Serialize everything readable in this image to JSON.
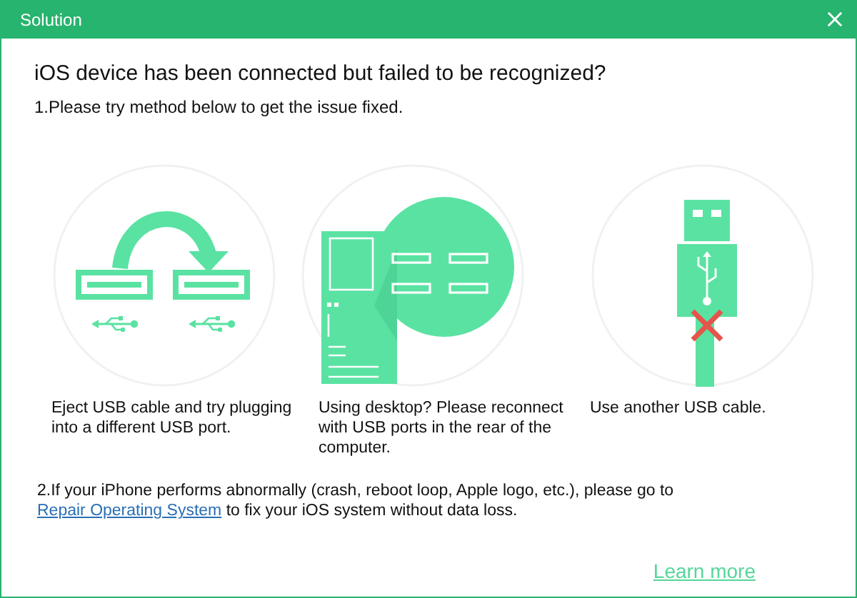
{
  "window": {
    "title": "Solution"
  },
  "heading": "iOS device has been connected but failed to be recognized?",
  "step_1": "1.Please try method below to get the issue fixed.",
  "methods": [
    {
      "kind": "swap",
      "caption": "Eject USB cable and try plugging into a different USB port."
    },
    {
      "kind": "desktop",
      "caption": "Using desktop? Please reconnect with USB ports in the rear of the computer."
    },
    {
      "kind": "cable",
      "caption": "Use another USB cable."
    }
  ],
  "step_2": {
    "before": "2.If your iPhone performs abnormally (crash, reboot loop, Apple logo, etc.), please go to",
    "link": "Repair Operating System",
    "after": "to fix your iOS system without data loss."
  },
  "learn_more": "Learn more"
}
